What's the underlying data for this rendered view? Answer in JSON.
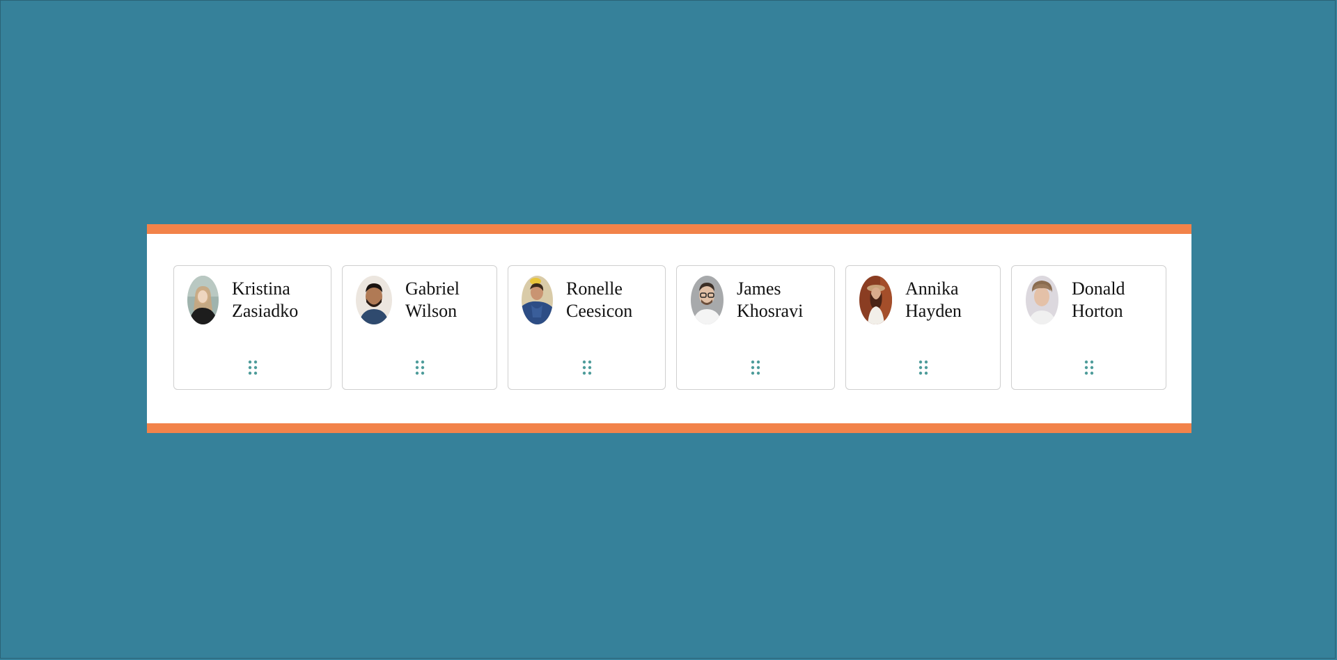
{
  "people": [
    {
      "first": "Kristina",
      "last": "Zasiadko"
    },
    {
      "first": "Gabriel",
      "last": "Wilson"
    },
    {
      "first": "Ronelle",
      "last": "Ceesicon"
    },
    {
      "first": "James",
      "last": "Khosravi"
    },
    {
      "first": "Annika",
      "last": "Hayden"
    },
    {
      "first": "Donald",
      "last": "Horton"
    }
  ],
  "icons": {
    "drag_handle": "grip-dots-icon"
  },
  "colors": {
    "background": "#36819a",
    "accent": "#f2834a",
    "handle": "#4e9c9a"
  }
}
